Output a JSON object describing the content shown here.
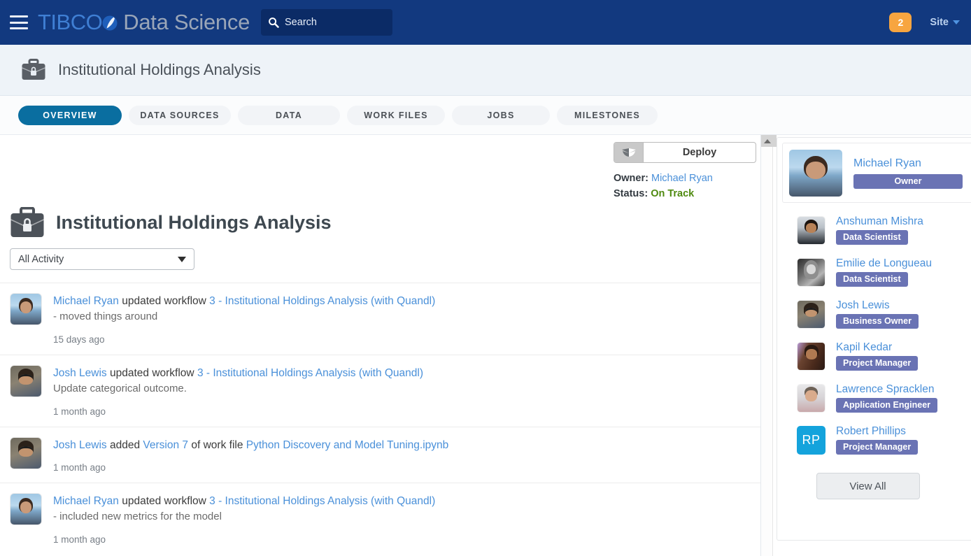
{
  "topnav": {
    "menu_icon": "hamburger-icon",
    "brand_tibco": "TIBCO",
    "brand_product": "Data Science",
    "search": {
      "icon": "search-icon",
      "placeholder": "Search",
      "value": "Search"
    },
    "notifications_count": "2",
    "site_menu_label": "Site",
    "colors": {
      "header_bg": "#12397f",
      "search_bg": "#0b2b66",
      "badge": "#f7a540",
      "brand_blue": "#3f7fd4"
    }
  },
  "titlebar": {
    "icon": "briefcase-lock-icon",
    "title": "Institutional Holdings Analysis"
  },
  "tabs": [
    {
      "label": "OVERVIEW",
      "active": true
    },
    {
      "label": "DATA SOURCES",
      "active": false
    },
    {
      "label": "DATA",
      "active": false
    },
    {
      "label": "WORK FILES",
      "active": false
    },
    {
      "label": "JOBS",
      "active": false
    },
    {
      "label": "MILESTONES",
      "active": false
    }
  ],
  "main": {
    "deploy": {
      "label": "Deploy",
      "icon": "deploy-fan-icon"
    },
    "owner_label": "Owner:",
    "owner_name": "Michael Ryan",
    "status_label": "Status:",
    "status_value": "On Track",
    "status_color": "#4f8a10",
    "project_icon": "briefcase-lock-icon",
    "project_title": "Institutional Holdings Analysis",
    "activity_filter": {
      "value": "All Activity",
      "icon": "chevron-down-icon"
    },
    "activity": [
      {
        "actor": "Michael Ryan",
        "verb": "updated workflow",
        "target": "3 - Institutional Holdings Analysis (with Quandl)",
        "description": "- moved things around",
        "time": "15 days ago",
        "avatar": "michael"
      },
      {
        "actor": "Josh Lewis",
        "verb": "updated workflow",
        "target": "3 - Institutional Holdings Analysis (with Quandl)",
        "description": "Update categorical outcome.",
        "time": "1 month ago",
        "avatar": "josh"
      },
      {
        "actor": "Josh Lewis",
        "verb": "added",
        "link2": "Version 7",
        "verb2": "of work file",
        "target": "Python Discovery and Model Tuning.ipynb",
        "description": "",
        "time": "1 month ago",
        "avatar": "josh"
      },
      {
        "actor": "Michael Ryan",
        "verb": "updated workflow",
        "target": "3 - Institutional Holdings Analysis (with Quandl)",
        "description": "- included new metrics for the model",
        "time": "1 month ago",
        "avatar": "michael"
      }
    ]
  },
  "sidebar": {
    "scrollbar": {
      "up_arrow_icon": "scroll-up-arrow-icon"
    },
    "owner": {
      "name": "Michael Ryan",
      "role": "Owner",
      "avatar": "michael"
    },
    "members": [
      {
        "name": "Anshuman Mishra",
        "role": "Data Scientist",
        "avatar": "anshuman"
      },
      {
        "name": "Emilie de Longueau",
        "role": "Data Scientist",
        "avatar": "emilie"
      },
      {
        "name": "Josh Lewis",
        "role": "Business Owner",
        "avatar": "josh"
      },
      {
        "name": "Kapil Kedar",
        "role": "Project Manager",
        "avatar": "kapil"
      },
      {
        "name": "Lawrence Spracklen",
        "role": "Application Engineer",
        "avatar": "lawrence"
      },
      {
        "name": "Robert Phillips",
        "role": "Project Manager",
        "avatar": "initials",
        "initials": "RP"
      }
    ],
    "view_all_label": "View All",
    "role_badge_color": "#6a73b4"
  }
}
